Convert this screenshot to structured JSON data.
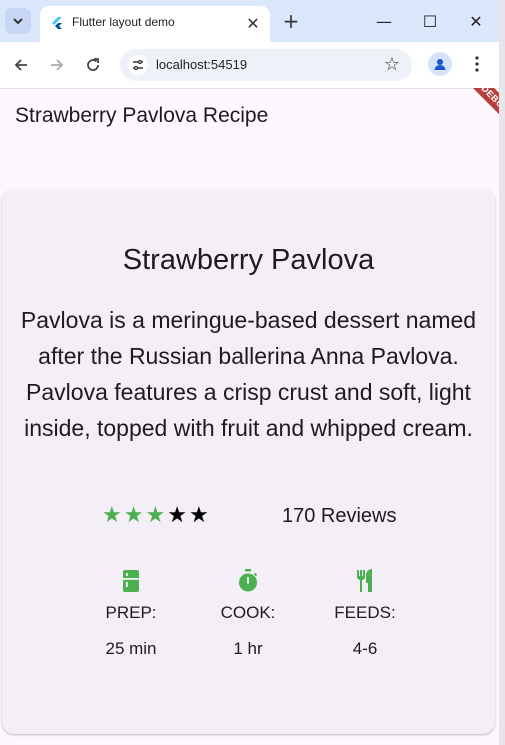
{
  "browser": {
    "tab_title": "Flutter layout demo",
    "tab_close": "✕",
    "new_tab": "+",
    "url": "localhost:54519",
    "window_controls": {
      "minimize": "—",
      "maximize": "☐",
      "close": "✕"
    }
  },
  "app": {
    "title": "Strawberry Pavlova Recipe",
    "debug_banner": "DEBUG"
  },
  "card": {
    "title": "Strawberry Pavlova",
    "description": "Pavlova is a meringue-based dessert named after the Russian ballerina Anna Pavlova. Pavlova features a crisp crust and soft, light inside, topped with fruit and whipped cream.",
    "rating": 3,
    "rating_max": 5,
    "rating_color": "#4caf50",
    "reviews": "170 Reviews",
    "info": [
      {
        "icon": "kitchen-icon",
        "label": "PREP:",
        "value": "25 min"
      },
      {
        "icon": "timer-icon",
        "label": "COOK:",
        "value": "1 hr"
      },
      {
        "icon": "restaurant-icon",
        "label": "FEEDS:",
        "value": "4-6"
      }
    ]
  }
}
